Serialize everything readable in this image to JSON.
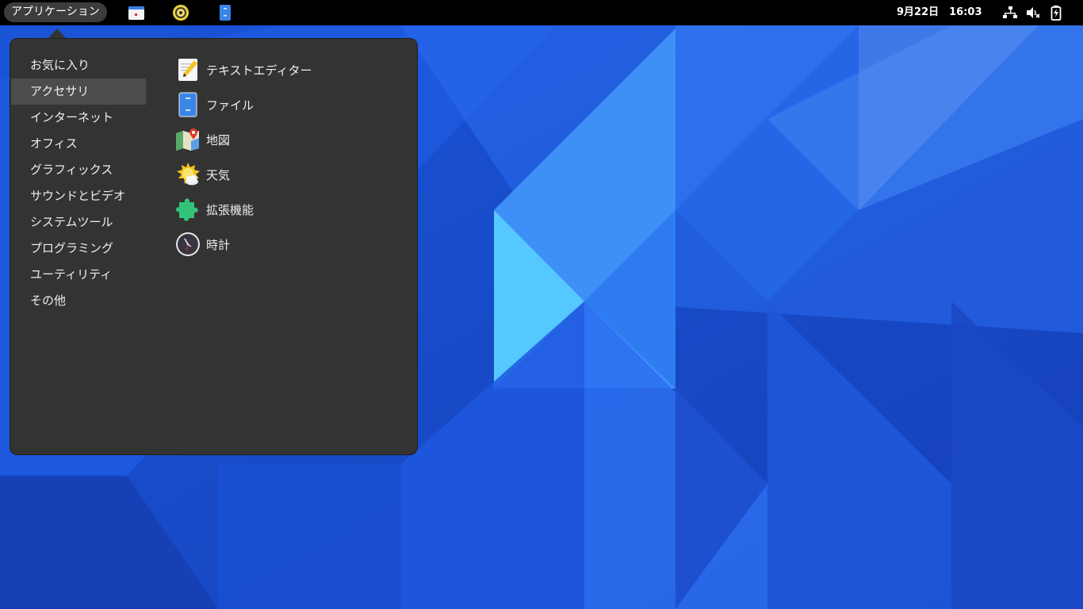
{
  "topbar": {
    "apps_button_label": "アプリケーション",
    "clock": "9月22日　16:03",
    "launchers": [
      {
        "name": "calendar-icon"
      },
      {
        "name": "rhythmbox-icon"
      },
      {
        "name": "files-icon"
      }
    ],
    "status_icons": [
      "network-wired-icon",
      "volume-muted-icon",
      "battery-charging-icon"
    ]
  },
  "menu": {
    "categories": [
      {
        "label": "お気に入り",
        "selected": false
      },
      {
        "label": "アクセサリ",
        "selected": true
      },
      {
        "label": "インターネット",
        "selected": false
      },
      {
        "label": "オフィス",
        "selected": false
      },
      {
        "label": "グラフィックス",
        "selected": false
      },
      {
        "label": "サウンドとビデオ",
        "selected": false
      },
      {
        "label": "システムツール",
        "selected": false
      },
      {
        "label": "プログラミング",
        "selected": false
      },
      {
        "label": "ユーティリティ",
        "selected": false
      },
      {
        "label": "その他",
        "selected": false
      }
    ],
    "apps": [
      {
        "label": "テキストエディター",
        "icon": "text-editor-icon"
      },
      {
        "label": "ファイル",
        "icon": "files-icon"
      },
      {
        "label": "地図",
        "icon": "maps-icon"
      },
      {
        "label": "天気",
        "icon": "weather-icon"
      },
      {
        "label": "拡張機能",
        "icon": "extensions-icon"
      },
      {
        "label": "時計",
        "icon": "clock-icon"
      }
    ]
  },
  "colors": {
    "topbar": "#000000",
    "menu_background": "#333333",
    "selected_category": "#4c4c4c",
    "wallpaper_base": "#1b4fd0"
  }
}
